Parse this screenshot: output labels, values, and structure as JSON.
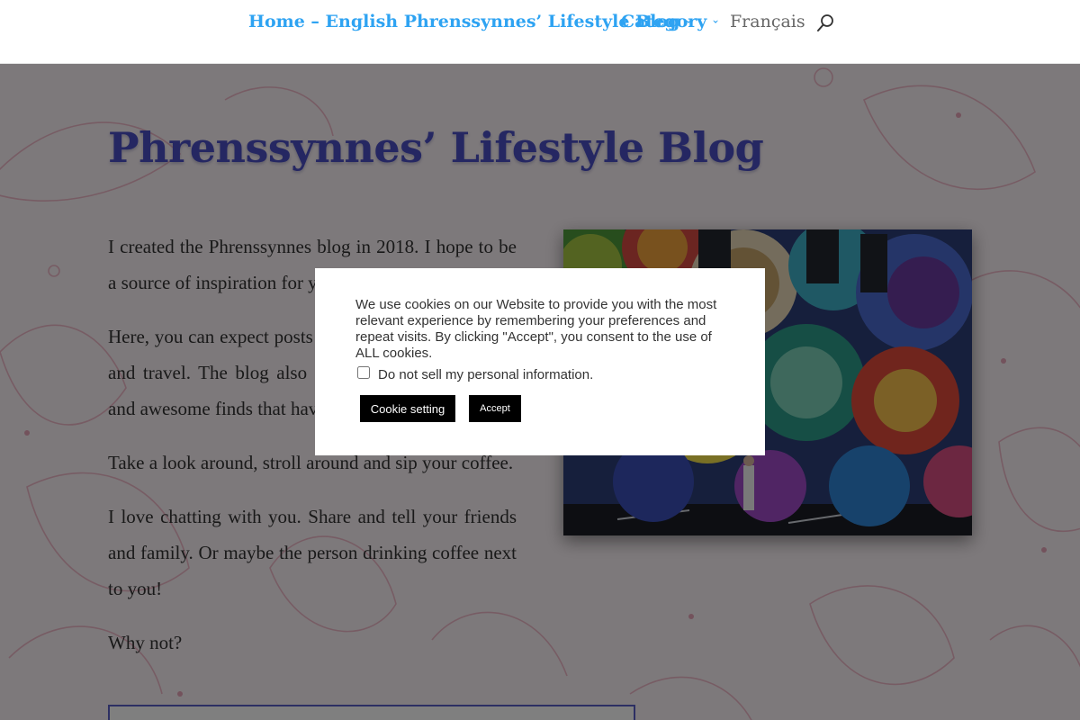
{
  "nav": {
    "items": [
      {
        "label": "Home – English Phrenssynnes’ Lifestyle Blog",
        "has_dropdown": true
      },
      {
        "label": "Category",
        "has_dropdown": true
      },
      {
        "label": "Français",
        "has_dropdown": false
      }
    ],
    "dropdown_glyph": "›",
    "search_icon": "search-icon"
  },
  "page": {
    "title": "Phrenssynnes’ Lifestyle Blog",
    "paragraphs": [
      "I created the Phrenssynnes blog in 2018. I hope to be a source of inspiration for you.",
      "Here, you can expect posts about lifestyle, food, style and travel. The blog also features recommendations and awesome finds that have a place in my heart.",
      "Take a look around, stroll around and sip your coffee.",
      "I love chatting with you. Share and tell your friends and family. Or maybe the person drinking coffee next to you!",
      "Why not?"
    ],
    "image": "colorful-mural-photo"
  },
  "cookie": {
    "text": "We use cookies on our Website to provide you with the most relevant experience by remembering your preferences and repeat visits. By clicking \"Accept\", you consent to the use of ALL cookies.",
    "checkbox_label": "Do not sell my personal information.",
    "checkbox_checked": false,
    "setting_label": "Cookie setting",
    "accept_label": "Accept"
  },
  "colors": {
    "link": "#2ea3f2",
    "title": "#4a4fc4",
    "page_bg": "#fbf3f7",
    "button": "#000000"
  }
}
